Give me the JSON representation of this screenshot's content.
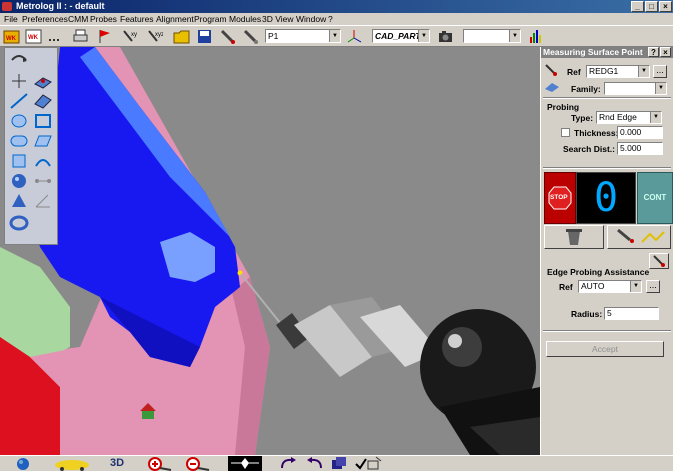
{
  "window": {
    "title": "Metrolog II : - default",
    "min": "_",
    "max": "□",
    "close": "×"
  },
  "menu": [
    "File",
    "Preferences",
    "CMM",
    "Probes",
    "Features",
    "Alignment",
    "Program",
    "Modules",
    "3D View",
    "Window",
    "?"
  ],
  "toolbar": {
    "left_icons": [
      "wk1-icon",
      "wk2-icon",
      "dots-icon",
      "printer-icon",
      "flag-red-icon",
      "probe-xy-icon",
      "probe-xyz-icon",
      "folder-icon",
      "save-icon",
      "probe-arrow-icon",
      "probe-pen-icon"
    ],
    "probe_combo": "P1",
    "cad_combo": "CAD_PART",
    "empty_combo": "",
    "right_icons": [
      "axis-icon",
      "camera-icon",
      "bar-chart-icon"
    ]
  },
  "palette": {
    "tools": [
      "measure-arrow-icon",
      "surface-point-icon",
      "point-icon",
      "surface-icon",
      "line-icon",
      "plane-icon",
      "circle-icon",
      "rect-icon",
      "slot-icon",
      "sphere-icon",
      "cylinder-icon",
      "cone-icon",
      "torus-icon",
      "curve-icon",
      "distance-icon",
      "angle-icon"
    ]
  },
  "panel": {
    "title": "Measuring Surface Point",
    "help": "?",
    "close": "×",
    "ref_label": "Ref",
    "ref_value": "REDG1",
    "family_label": "Family:",
    "family_value": "",
    "probing_group": "Probing",
    "type_label": "Type:",
    "type_value": "Rnd Edge",
    "thickness_label": "Thickness:",
    "thickness_value": "0.000",
    "thickness_checked": false,
    "search_label": "Search Dist.:",
    "search_value": "5.000",
    "stop_label": "STOP",
    "counter": "0",
    "cont_label": "CONT",
    "edge_group": "Edge Probing Assistance",
    "edge_ref_label": "Ref",
    "edge_ref_value": "AUTO",
    "radius_label": "Radius:",
    "radius_value": "5",
    "accept_label": "Accept",
    "dots": "..."
  },
  "bottombar": {
    "icons": [
      "globe-icon",
      "car-icon",
      "3d-view-icon",
      "zoom-in-icon",
      "zoom-out-icon",
      "fit-view-icon",
      "rotate-left-icon",
      "rotate-right-icon",
      "layers-icon",
      "check-grid-icon"
    ],
    "label_3d": "3D"
  },
  "colors": {
    "title_start": "#0a246a",
    "title_end": "#3a6ea5",
    "counter_bg": "#000000",
    "counter_fg": "#00a8ff",
    "stop": "#cc0000",
    "cont": "#5a9a9a",
    "part_blue": "#1a1aff",
    "part_pink": "#e08aaa"
  }
}
